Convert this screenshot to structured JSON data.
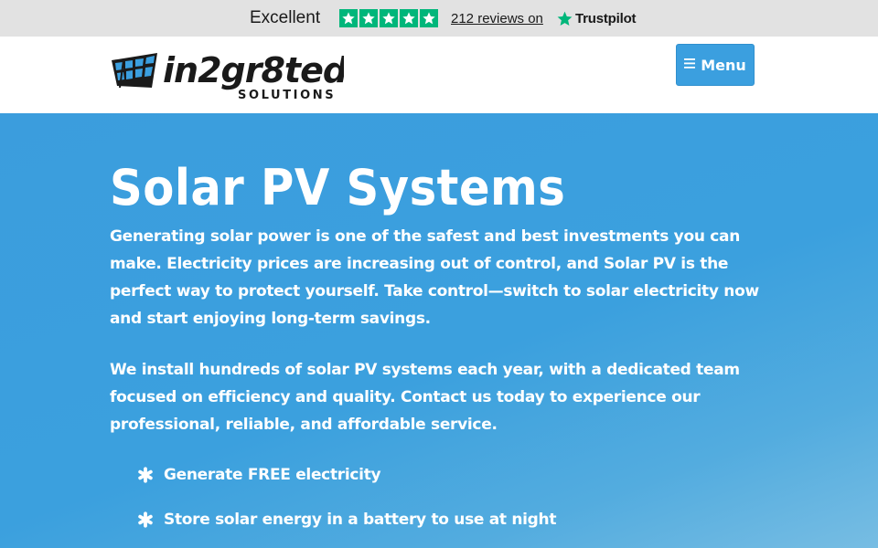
{
  "trustpilot": {
    "rating_word": "Excellent",
    "stars": 5,
    "reviews_link": "212 reviews on",
    "brand": "Trustpilot",
    "colors": {
      "star": "#00b67a",
      "bar_bg": "#e2e2e2"
    }
  },
  "header": {
    "logo": {
      "wordmark": "in2gr8ted",
      "subtitle": "SOLUTIONS",
      "icon": "solar-panel-logo-icon"
    },
    "menu_button": {
      "label": "Menu",
      "icon": "hamburger-icon"
    }
  },
  "hero": {
    "title": "Solar PV Systems",
    "paragraphs": [
      "Generating solar power is one of the safest and best investments you can make. Electricity prices are increasing out of control, and Solar PV is the perfect way to protect yourself. Take control—switch to solar electricity now and start enjoying long-term savings.",
      "We install hundreds of solar PV systems each year, with a dedicated team focused on efficiency and quality. Contact us today to experience our professional, reliable, and affordable service."
    ],
    "features": [
      {
        "label": "Generate FREE electricity",
        "icon": "asterisk-icon"
      },
      {
        "label": "Store solar energy in a battery to use at night",
        "icon": "asterisk-icon"
      }
    ],
    "colors": {
      "background": "#3b9fdf",
      "text": "#ffffff"
    }
  }
}
